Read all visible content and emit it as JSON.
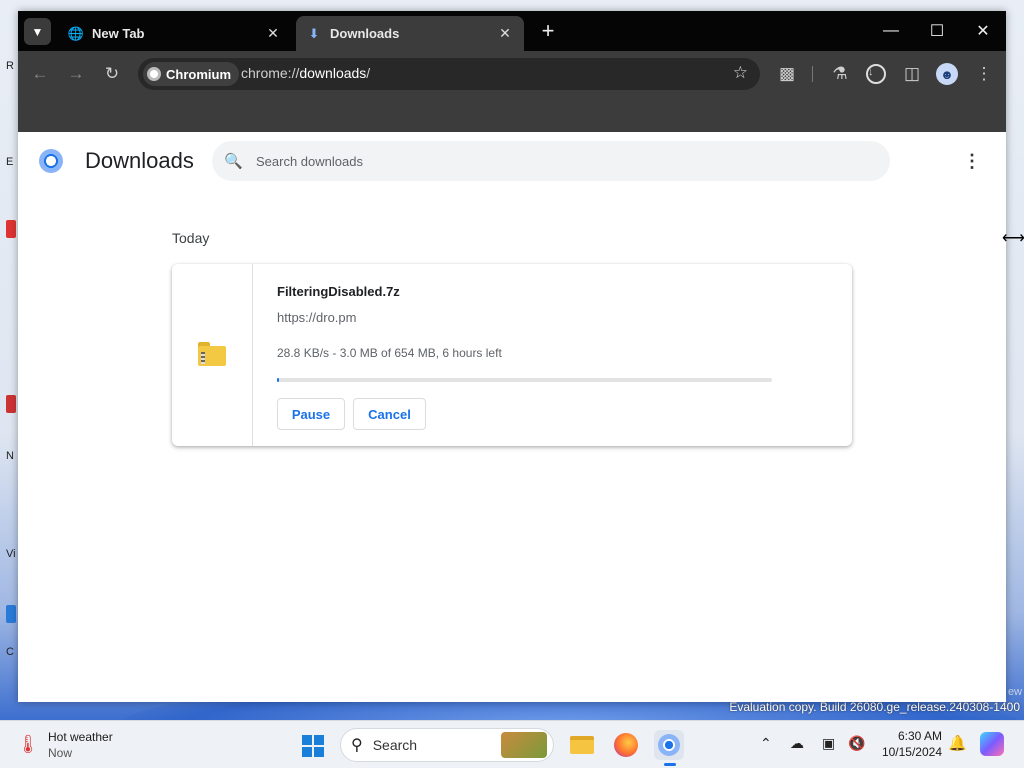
{
  "browser": {
    "tabs": [
      {
        "title": "New Tab",
        "icon": "globe-icon",
        "active": false
      },
      {
        "title": "Downloads",
        "icon": "download-icon",
        "active": true
      }
    ],
    "chip_label": "Chromium",
    "url_prefix": "chrome://",
    "url_host": "downloads",
    "url_suffix": "/"
  },
  "page": {
    "title": "Downloads",
    "search_placeholder": "Search downloads",
    "date_header": "Today",
    "download": {
      "file_name": "FilteringDisabled.7z",
      "source_url": "https://dro.pm",
      "status": "28.8 KB/s - 3.0 MB of 654 MB, 6 hours left",
      "progress_fraction": 0.0046,
      "pause_label": "Pause",
      "cancel_label": "Cancel"
    }
  },
  "desktop": {
    "watermark": "Evaluation copy. Build 26080.ge_release.240308-1400",
    "watermark_partial": "ew",
    "side_letters": [
      "R",
      "E",
      "N",
      "Vi",
      "C"
    ]
  },
  "taskbar": {
    "weather_title": "Hot weather",
    "weather_sub": "Now",
    "search_label": "Search",
    "time": "6:30 AM",
    "date": "10/15/2024"
  },
  "colors": {
    "accent": "#1a73e8",
    "tabstrip": "#050505",
    "toolbar": "#3c3c3c"
  }
}
